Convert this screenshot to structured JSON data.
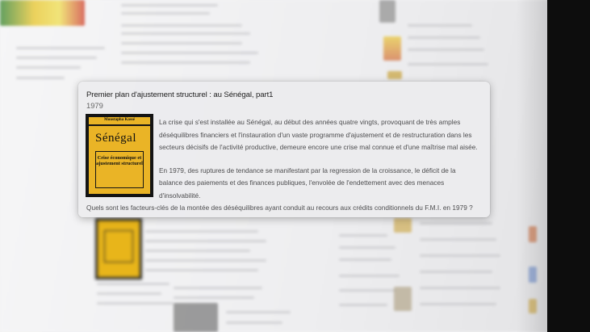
{
  "popup": {
    "title": "Premier plan d'ajustement structurel : au Sénégal, part1",
    "year": "1979",
    "book": {
      "author": "Moustapha Kassé",
      "country": "Sénégal",
      "subtitle": "Crise économique et ajustement structurel"
    },
    "paragraphs": [
      "La crise qui s'est installée au Sénégal, au début des années quatre vingts, provoquant de très amples déséquilibres financiers et l'instauration d'un vaste programme d'ajustement et de restructuration dans les secteurs décisifs de l'activité productive, demeure encore une crise mal connue et d'une maîtrise mal aisée.",
      "En 1979, des ruptures de tendance se manifestant par la regression de la croissance, le déficit de la balance des paiements et des finances publiques, l'envolée de l'endettement avec des menaces d'insolvabilité."
    ],
    "question": "Quels sont les facteurs-clés de la montée des déséquilibres ayant conduit au recours aux crédits conditionnels du F.M.I. en 1979 ?"
  },
  "colors": {
    "cover_yellow": "#eab426",
    "cover_border": "#141414",
    "card_bg": "#ececee"
  }
}
